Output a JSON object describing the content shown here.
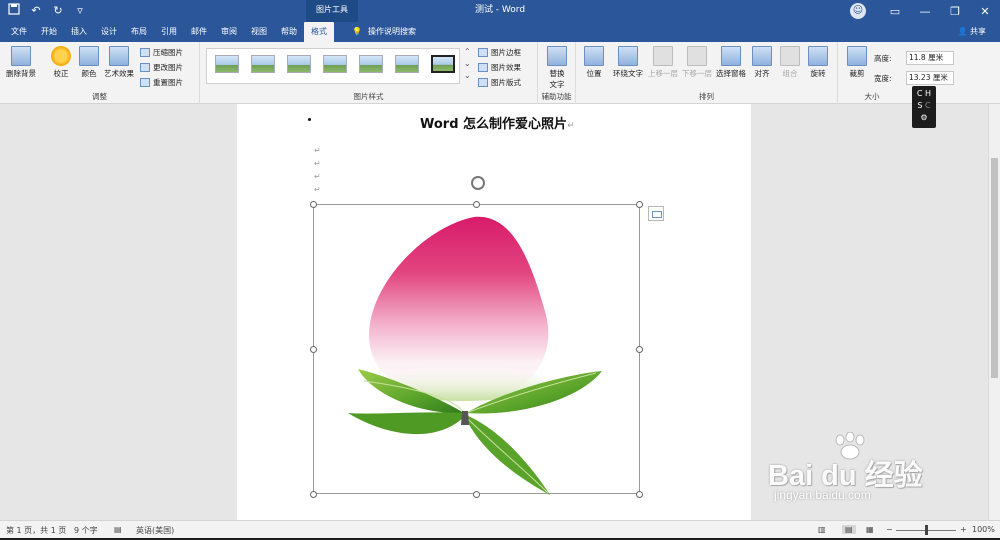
{
  "titlebar": {
    "qat": [
      "save-icon",
      "undo-icon",
      "redo-icon",
      "customize-icon"
    ],
    "context_title": "图片工具",
    "doc_title": "测试 - Word",
    "user_initial": "☺",
    "ribbon_display": "▭",
    "minimize": "—",
    "restore": "❐",
    "close": "✕"
  },
  "tabs": [
    "文件",
    "开始",
    "插入",
    "设计",
    "布局",
    "引用",
    "邮件",
    "审阅",
    "视图",
    "帮助",
    "格式"
  ],
  "active_tab": "格式",
  "tell_me": "操作说明搜索",
  "share": "共享",
  "ribbon": {
    "adjust": {
      "label": "调整",
      "remove_bg": "删除背景",
      "corrections": "校正",
      "color": "颜色",
      "artistic": "艺术效果",
      "compress": "压缩图片",
      "change": "更改图片",
      "reset": "重置图片"
    },
    "styles": {
      "label": "图片样式",
      "border": "图片边框",
      "effects": "图片效果",
      "layout": "图片版式"
    },
    "accessibility": {
      "label": "辅助功能",
      "alt_text_1": "替换",
      "alt_text_2": "文字"
    },
    "arrange": {
      "label": "排列",
      "position": "位置",
      "wrap": "环绕文字",
      "forward": "上移一层",
      "backward": "下移一层",
      "selection": "选择窗格",
      "align": "对齐",
      "group": "组合",
      "rotate": "旋转"
    },
    "size": {
      "label": "大小",
      "crop": "裁剪",
      "height_label": "高度:",
      "height_value": "11.8 厘米",
      "width_label": "宽度:",
      "width_value": "13.23 厘米"
    }
  },
  "document": {
    "heading": "Word 怎么制作爱心照片",
    "para_mark": "↵"
  },
  "ime": {
    "line1": "C H",
    "line2": "S",
    "line2b": "C"
  },
  "watermark": {
    "main": "Bai du 经验",
    "sub": "jingyan.baidu.com"
  },
  "statusbar": {
    "page": "第 1 页，共 1 页",
    "words": "9 个字",
    "language": "英语(美国)",
    "zoom_minus": "−",
    "zoom_plus": "+",
    "zoom": "100%"
  },
  "colors": {
    "ribbon_blue": "#2b579a",
    "peach_pink": "#e1307a",
    "leaf_green": "#5aa32a"
  }
}
